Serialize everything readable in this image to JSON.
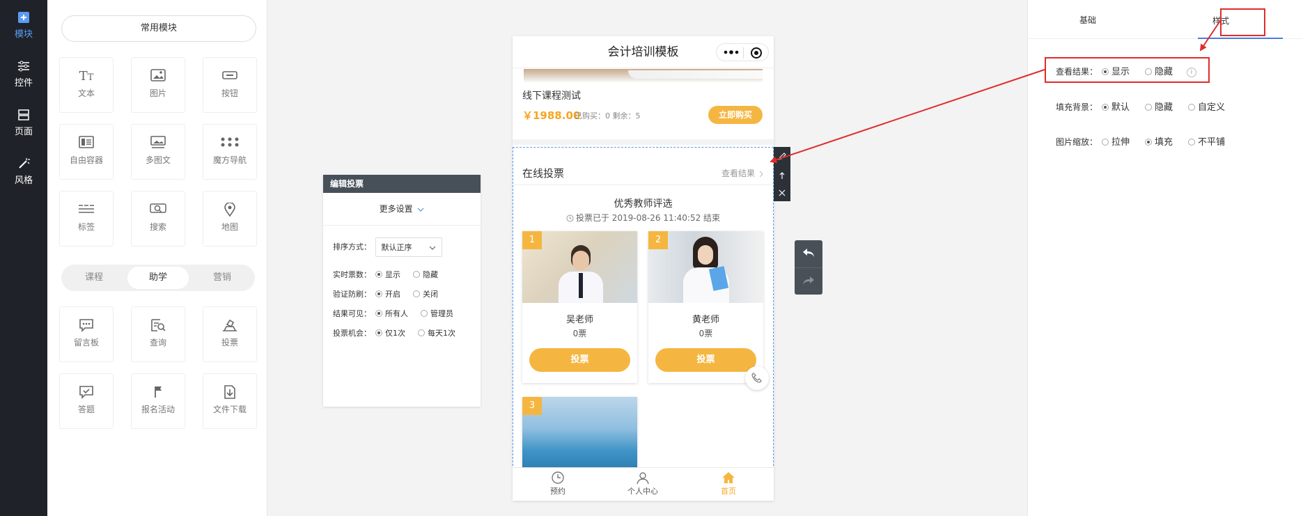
{
  "rail": {
    "items": [
      {
        "label": "模块",
        "icon": "plus-square-icon",
        "active": true
      },
      {
        "label": "控件",
        "icon": "sliders-icon",
        "active": false
      },
      {
        "label": "页面",
        "icon": "page-layout-icon",
        "active": false
      },
      {
        "label": "风格",
        "icon": "magic-wand-icon",
        "active": false
      }
    ]
  },
  "modules": {
    "common_label": "常用模块",
    "common": [
      {
        "label": "文本",
        "icon": "text-icon"
      },
      {
        "label": "图片",
        "icon": "image-icon"
      },
      {
        "label": "按钮",
        "icon": "button-icon"
      },
      {
        "label": "自由容器",
        "icon": "container-icon"
      },
      {
        "label": "多图文",
        "icon": "multi-image-text-icon"
      },
      {
        "label": "魔方导航",
        "icon": "grid-nav-icon"
      },
      {
        "label": "标签",
        "icon": "tag-icon"
      },
      {
        "label": "搜索",
        "icon": "search-icon"
      },
      {
        "label": "地图",
        "icon": "map-pin-icon"
      }
    ],
    "tabs": [
      "课程",
      "助学",
      "营销"
    ],
    "active_tab": "助学",
    "study": [
      {
        "label": "留言板",
        "icon": "message-board-icon"
      },
      {
        "label": "查询",
        "icon": "query-icon"
      },
      {
        "label": "投票",
        "icon": "vote-icon"
      },
      {
        "label": "答题",
        "icon": "quiz-icon"
      },
      {
        "label": "报名活动",
        "icon": "flag-icon"
      },
      {
        "label": "文件下载",
        "icon": "file-download-icon"
      }
    ]
  },
  "edit_vote": {
    "title": "编辑投票",
    "more_settings": "更多设置",
    "sort_label": "排序方式：",
    "sort_value": "默认正序",
    "rows": [
      {
        "label": "实时票数：",
        "opt1": "显示",
        "opt2": "隐藏"
      },
      {
        "label": "验证防刷：",
        "opt1": "开启",
        "opt2": "关闭"
      },
      {
        "label": "结果可见：",
        "opt1": "所有人",
        "opt2": "管理员"
      },
      {
        "label": "投票机会：",
        "opt1": "仅1次",
        "opt2": "每天1次"
      }
    ]
  },
  "phone": {
    "title": "会计培训模板",
    "course": {
      "name": "线下课程测试",
      "price": "￥1988.00",
      "meta": "已购买：0 剩余：5",
      "buy": "立即购买"
    },
    "vote": {
      "section_title": "在线投票",
      "view_results": "查看结果",
      "heading": "优秀教师评选",
      "deadline": "投票已于 2019-08-26 11:40:52 结束",
      "vote_button": "投票",
      "candidates": [
        {
          "num": "1",
          "name": "吴老师",
          "votes": "0票"
        },
        {
          "num": "2",
          "name": "黄老师",
          "votes": "0票"
        },
        {
          "num": "3",
          "name": "",
          "votes": ""
        }
      ]
    },
    "tabbar": [
      {
        "label": "预约",
        "icon": "clock-icon",
        "active": false
      },
      {
        "label": "个人中心",
        "icon": "user-icon",
        "active": false
      },
      {
        "label": "首页",
        "icon": "home-icon",
        "active": true
      }
    ],
    "accent": "#f5b641"
  },
  "right_panel": {
    "tabs": [
      "基础",
      "样式"
    ],
    "active_tab": "样式",
    "rows": [
      {
        "label": "查看结果：",
        "options": [
          "显示",
          "隐藏"
        ],
        "selected": 0,
        "info": "i"
      },
      {
        "label": "填充背景：",
        "options": [
          "默认",
          "隐藏",
          "自定义"
        ],
        "selected": 0
      },
      {
        "label": "图片缩放：",
        "options": [
          "拉伸",
          "填充",
          "不平铺"
        ],
        "selected": 1
      }
    ]
  },
  "colors": {
    "highlight_red": "#e02b2b",
    "accent_blue": "#5b9cf2",
    "rail_bg": "#1f2329"
  }
}
